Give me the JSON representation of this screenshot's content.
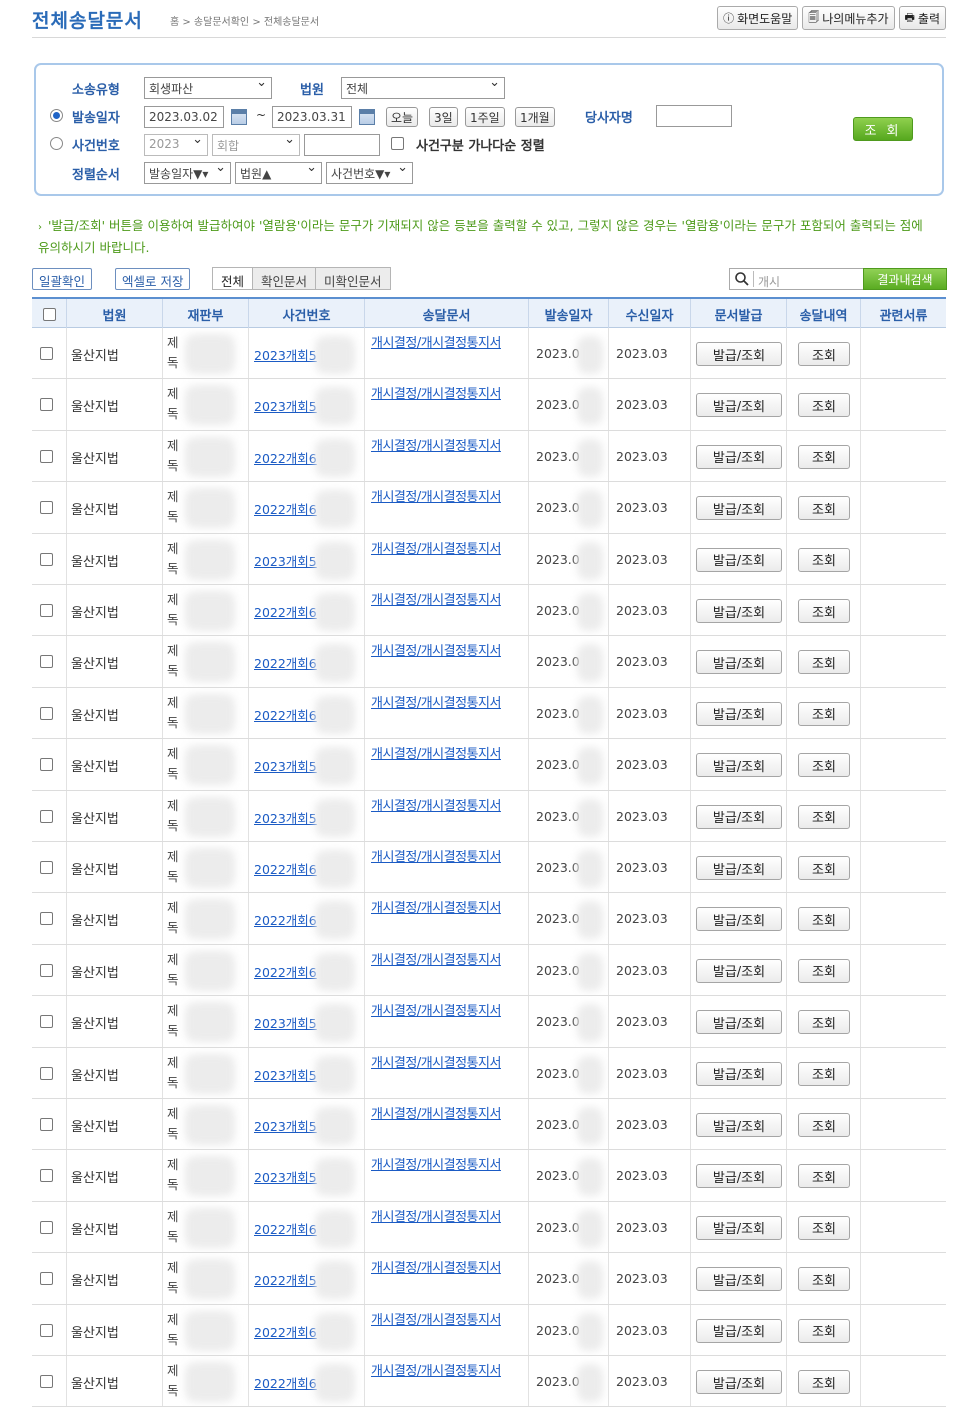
{
  "header": {
    "title": "전체송달문서",
    "breadcrumb": "홈 > 송달문서확인 > 전체송달문서",
    "help_label": "화면도움말",
    "add_menu_label": "나의메뉴추가",
    "print_label": "출력"
  },
  "search": {
    "case_type_label": "소송유형",
    "case_type_value": "회생파산",
    "court_label": "법원",
    "court_value": "전체",
    "send_date_label": "발송일자",
    "date_from": "2023.03.02",
    "date_sep": "~",
    "date_to": "2023.03.31",
    "quick_today": "오늘",
    "quick_3d": "3일",
    "quick_1w": "1주일",
    "quick_1m": "1개월",
    "party_label": "당사자명",
    "party_value": "",
    "case_no_label": "사건번호",
    "case_year": "2023",
    "case_kind": "회합",
    "case_no_value": "",
    "sort_by_case_label": "사건구분 가나다순 정렬",
    "order_label": "정렬순서",
    "order_1": "발송일자▼▾",
    "order_2": "법원▲",
    "order_3": "사건번호▼▾",
    "submit_label": "조 회",
    "selected_mode": "발송일자"
  },
  "notice": "'발급/조회' 버튼을 이용하여 발급하여야 '열람용'이라는 문구가 기재되지 않은 등본을 출력할 수 있고, 그렇지 않은 경우는 '열람용'이라는 문구가 포함되어 출력되는 점에 유의하시기 바랍니다.",
  "toolbar": {
    "bulk_confirm": "일괄확인",
    "excel_save": "엑셀로 저장",
    "tabs": [
      "전체",
      "확인문서",
      "미확인문서"
    ],
    "filter_placeholder": "개시",
    "refine_search": "결과내검색"
  },
  "table": {
    "columns": [
      "",
      "법원",
      "재판부",
      "사건번호",
      "송달문서",
      "발송일자",
      "수신일자",
      "문서발급",
      "송달내역",
      "관련서류"
    ],
    "issue_label": "발급/조회",
    "history_label": "조회",
    "rows": [
      {
        "court": "울산지법",
        "dept": "제\n독",
        "case_no": "2023개회5",
        "doc": "개시결정/개시결정통지서",
        "send": "2023.0",
        "recv": "2023.03"
      },
      {
        "court": "울산지법",
        "dept": "제\n독",
        "case_no": "2023개회5",
        "doc": "개시결정/개시결정통지서",
        "send": "2023.0",
        "recv": "2023.03"
      },
      {
        "court": "울산지법",
        "dept": "제\n독",
        "case_no": "2022개회6",
        "doc": "개시결정/개시결정통지서",
        "send": "2023.0",
        "recv": "2023.03"
      },
      {
        "court": "울산지법",
        "dept": "제\n독",
        "case_no": "2022개회6",
        "doc": "개시결정/개시결정통지서",
        "send": "2023.0",
        "recv": "2023.03"
      },
      {
        "court": "울산지법",
        "dept": "제\n독",
        "case_no": "2023개회5",
        "doc": "개시결정/개시결정통지서",
        "send": "2023.0",
        "recv": "2023.03"
      },
      {
        "court": "울산지법",
        "dept": "제\n독",
        "case_no": "2022개회6",
        "doc": "개시결정/개시결정통지서",
        "send": "2023.0",
        "recv": "2023.03"
      },
      {
        "court": "울산지법",
        "dept": "제\n독",
        "case_no": "2022개회6",
        "doc": "개시결정/개시결정통지서",
        "send": "2023.0",
        "recv": "2023.03"
      },
      {
        "court": "울산지법",
        "dept": "제\n독",
        "case_no": "2022개회6",
        "doc": "개시결정/개시결정통지서",
        "send": "2023.0",
        "recv": "2023.03"
      },
      {
        "court": "울산지법",
        "dept": "제\n독",
        "case_no": "2023개회5",
        "doc": "개시결정/개시결정통지서",
        "send": "2023.0",
        "recv": "2023.03"
      },
      {
        "court": "울산지법",
        "dept": "제\n독",
        "case_no": "2023개회5",
        "doc": "개시결정/개시결정통지서",
        "send": "2023.0",
        "recv": "2023.03"
      },
      {
        "court": "울산지법",
        "dept": "제\n독",
        "case_no": "2022개회6",
        "doc": "개시결정/개시결정통지서",
        "send": "2023.0",
        "recv": "2023.03"
      },
      {
        "court": "울산지법",
        "dept": "제\n독",
        "case_no": "2022개회6",
        "doc": "개시결정/개시결정통지서",
        "send": "2023.0",
        "recv": "2023.03"
      },
      {
        "court": "울산지법",
        "dept": "제\n독",
        "case_no": "2022개회6",
        "doc": "개시결정/개시결정통지서",
        "send": "2023.0",
        "recv": "2023.03"
      },
      {
        "court": "울산지법",
        "dept": "제\n독",
        "case_no": "2023개회5",
        "doc": "개시결정/개시결정통지서",
        "send": "2023.0",
        "recv": "2023.03"
      },
      {
        "court": "울산지법",
        "dept": "제\n독",
        "case_no": "2023개회5",
        "doc": "개시결정/개시결정통지서",
        "send": "2023.0",
        "recv": "2023.03"
      },
      {
        "court": "울산지법",
        "dept": "제\n독",
        "case_no": "2023개회5",
        "doc": "개시결정/개시결정통지서",
        "send": "2023.0",
        "recv": "2023.03"
      },
      {
        "court": "울산지법",
        "dept": "제\n독",
        "case_no": "2023개회5",
        "doc": "개시결정/개시결정통지서",
        "send": "2023.0",
        "recv": "2023.03"
      },
      {
        "court": "울산지법",
        "dept": "제\n독",
        "case_no": "2022개회6",
        "doc": "개시결정/개시결정통지서",
        "send": "2023.0",
        "recv": "2023.03"
      },
      {
        "court": "울산지법",
        "dept": "제\n독",
        "case_no": "2022개회5",
        "doc": "개시결정/개시결정통지서",
        "send": "2023.0",
        "recv": "2023.03"
      },
      {
        "court": "울산지법",
        "dept": "제\n독",
        "case_no": "2022개회6",
        "doc": "개시결정/개시결정통지서",
        "send": "2023.0",
        "recv": "2023.03"
      },
      {
        "court": "울산지법",
        "dept": "제\n독",
        "case_no": "2022개회6",
        "doc": "개시결정/개시결정통지서",
        "send": "2023.0",
        "recv": "2023.03"
      }
    ]
  },
  "colors": {
    "title_blue": "#2a6bb8",
    "label_blue": "#2a5ea8",
    "link_blue": "#1b5bc4",
    "notice_green": "#4d9a1a",
    "button_green": "#56a81e"
  }
}
